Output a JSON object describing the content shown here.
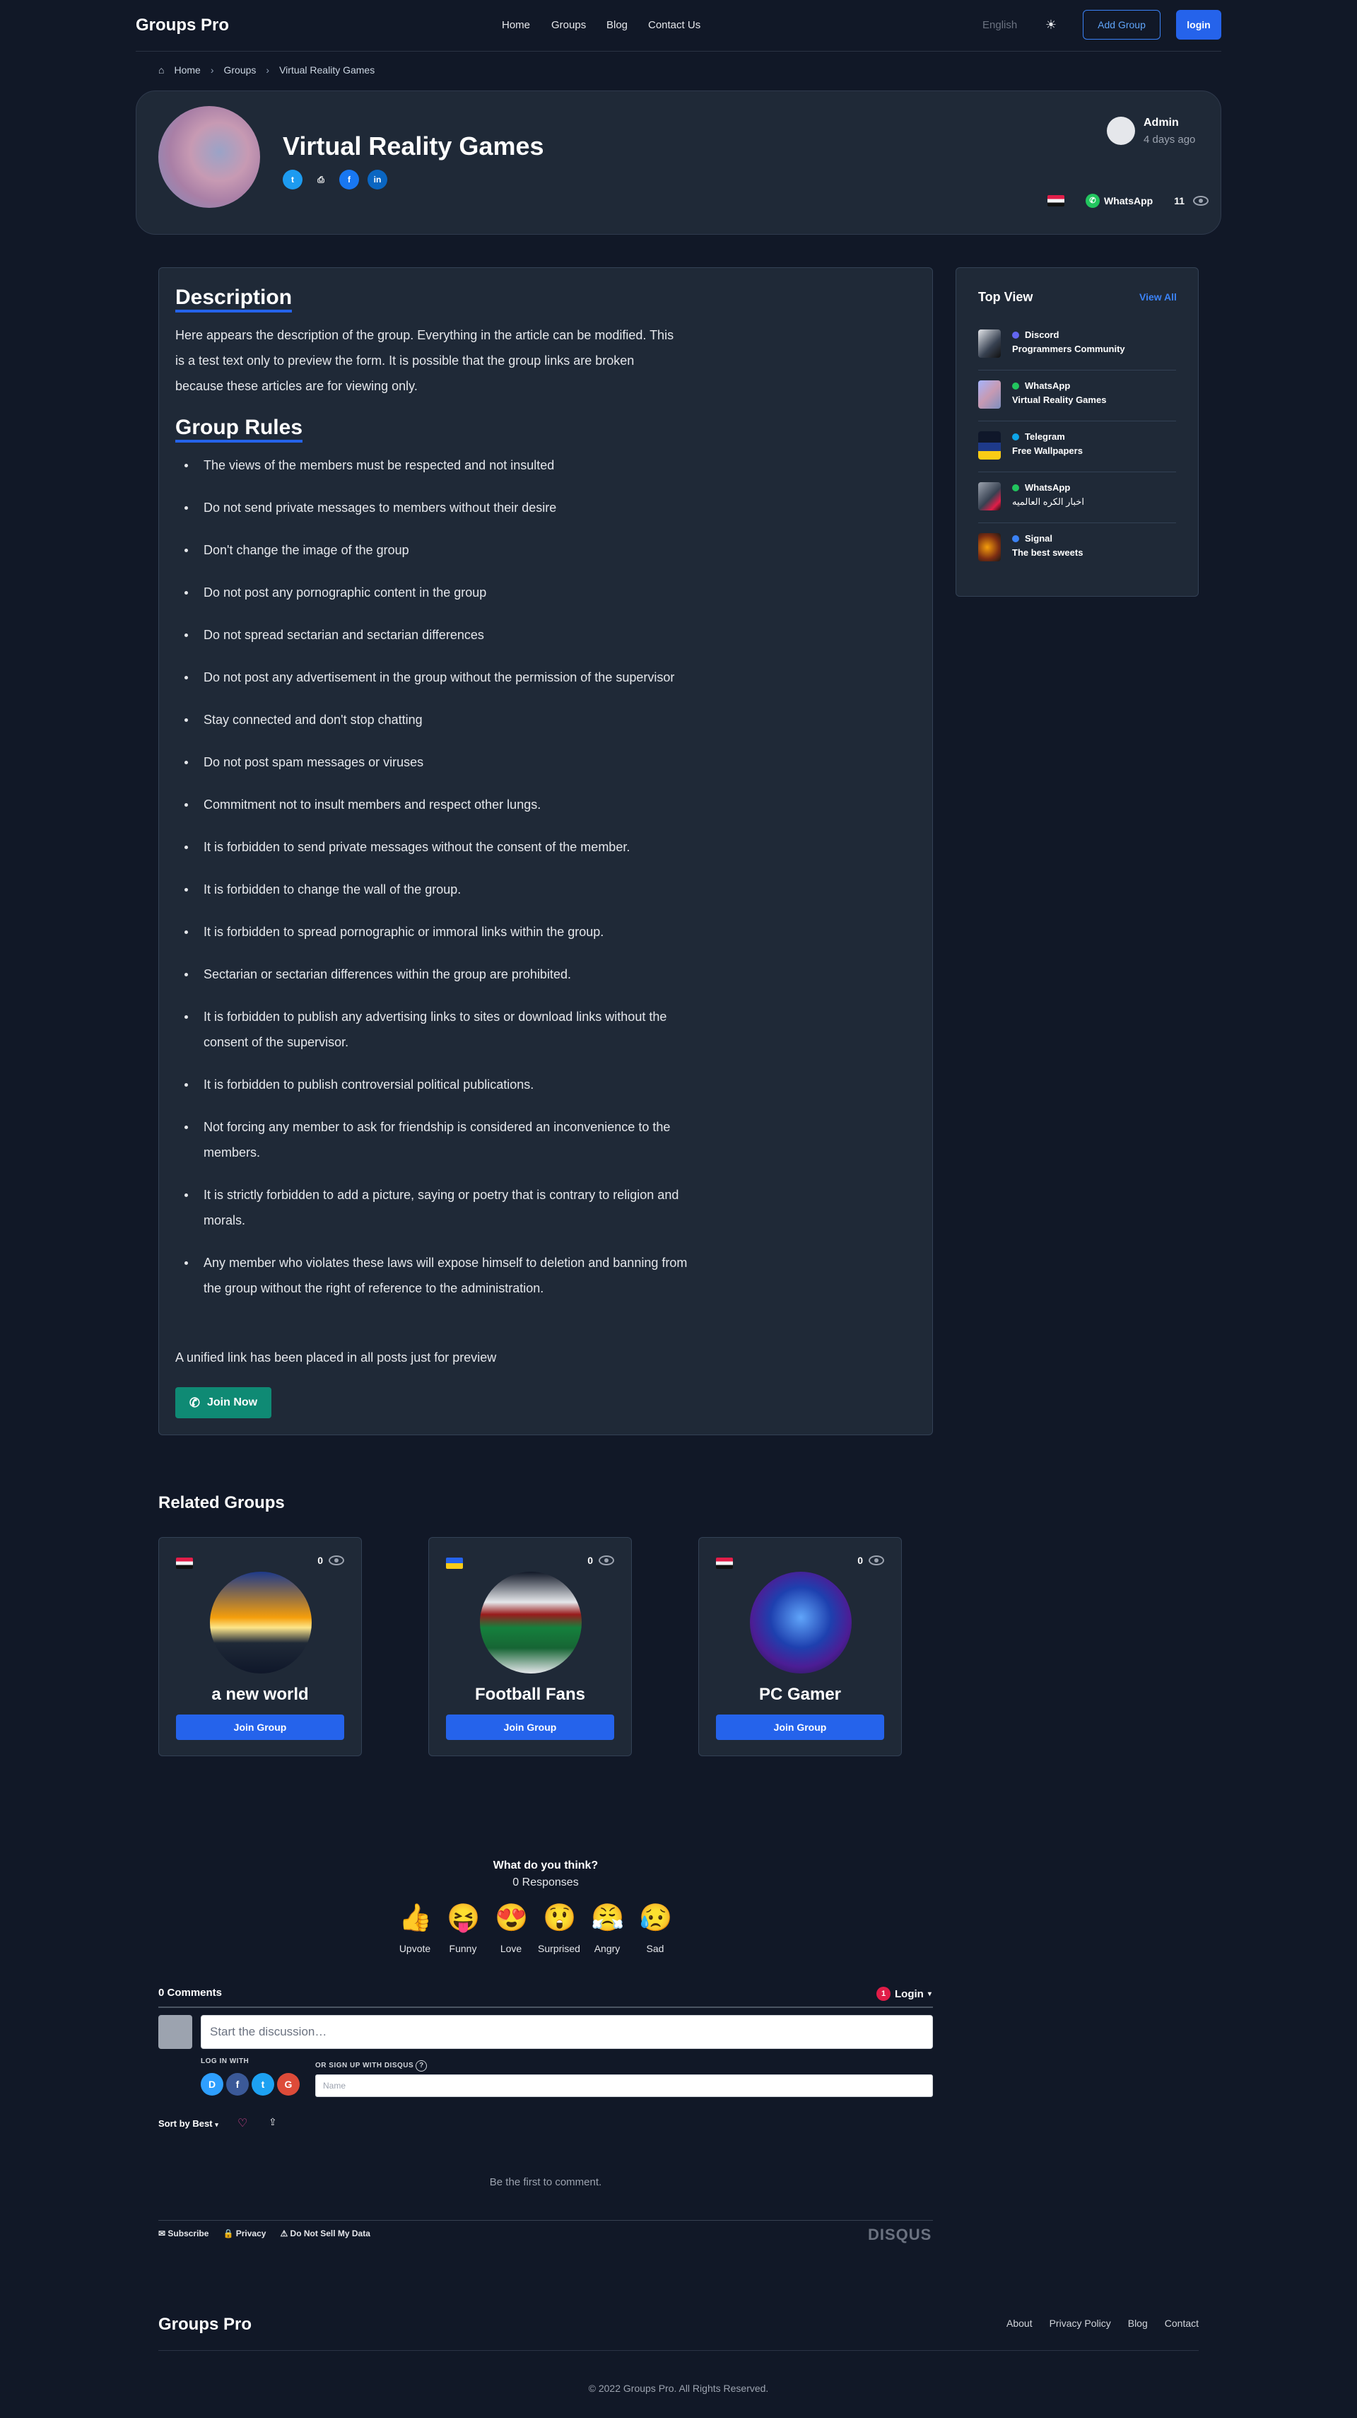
{
  "header": {
    "logo": "Groups Pro",
    "nav": [
      "Home",
      "Groups",
      "Blog",
      "Contact Us"
    ],
    "language": "English",
    "add_group": "Add Group",
    "login": "login"
  },
  "breadcrumb": [
    "Home",
    "Groups",
    "Virtual Reality Games"
  ],
  "group": {
    "title": "Virtual Reality Games",
    "author": "Admin",
    "time": "4 days ago",
    "platform": "WhatsApp",
    "views": "11"
  },
  "content": {
    "description_title": "Description",
    "description": "Here appears the description of the group. Everything in the article can be modified. This is a test text only to preview the form. It is possible that the group links are broken because these articles are for viewing only.",
    "rules_title": "Group Rules",
    "rules": [
      "The views of the members must be respected and not insulted",
      "Do not send private messages to members without their desire",
      "Don't change the image of the group",
      "Do not post any pornographic content in the group",
      "Do not spread sectarian and sectarian differences",
      "Do not post any advertisement in the group without the permission of the supervisor",
      "Stay connected and don't stop chatting",
      "Do not post spam messages or viruses",
      "Commitment not to insult members and respect other lungs.",
      "It is forbidden to send private messages without the consent of the member.",
      "It is forbidden to change the wall of the group.",
      "It is forbidden to spread pornographic or immoral links within the group.",
      "Sectarian or sectarian differences within the group are prohibited.",
      "It is forbidden to publish any advertising links to sites or download links without the consent of the supervisor.",
      "It is forbidden to publish controversial political publications.",
      "Not forcing any member to ask for friendship is considered an inconvenience to the members.",
      "It is strictly forbidden to add a picture, saying or poetry that is contrary to religion and morals.",
      "Any member who violates these laws will expose himself to deletion and banning from the group without the right of reference to the administration."
    ],
    "unified_note": "A unified link has been placed in all posts just for preview",
    "join_now": "Join Now"
  },
  "top_view": {
    "title": "Top View",
    "view_all": "View All",
    "items": [
      {
        "platform": "Discord",
        "name": "Programmers Community",
        "color": "#6366f1"
      },
      {
        "platform": "WhatsApp",
        "name": "Virtual Reality Games",
        "color": "#22c55e"
      },
      {
        "platform": "Telegram",
        "name": "Free Wallpapers",
        "color": "#0ea5e9"
      },
      {
        "platform": "WhatsApp",
        "name": "اخبار الكره العالميه",
        "color": "#22c55e"
      },
      {
        "platform": "Signal",
        "name": "The best sweets",
        "color": "#3b82f6"
      }
    ]
  },
  "related": {
    "title": "Related Groups",
    "join_label": "Join Group",
    "items": [
      {
        "name": "a new world",
        "views": "0",
        "flag": "eg"
      },
      {
        "name": "Football Fans",
        "views": "0",
        "flag": "ua"
      },
      {
        "name": "PC Gamer",
        "views": "0",
        "flag": "eg"
      }
    ]
  },
  "reactions": {
    "question": "What do you think?",
    "responses": "0 Responses",
    "items": [
      {
        "emoji": "👍",
        "label": "Upvote"
      },
      {
        "emoji": "😝",
        "label": "Funny"
      },
      {
        "emoji": "😍",
        "label": "Love"
      },
      {
        "emoji": "😲",
        "label": "Surprised"
      },
      {
        "emoji": "😤",
        "label": "Angry"
      },
      {
        "emoji": "😥",
        "label": "Sad"
      }
    ]
  },
  "disqus": {
    "comments": "0 Comments",
    "login": "Login",
    "login_badge": "1",
    "placeholder": "Start the discussion…",
    "log_in_with": "LOG IN WITH",
    "or_sign_up": "OR SIGN UP WITH DISQUS",
    "name_placeholder": "Name",
    "sort": "Sort by Best",
    "first": "Be the first to comment.",
    "subscribe": "Subscribe",
    "privacy": "Privacy",
    "do_not_sell": "Do Not Sell My Data",
    "brand": "DISQUS"
  },
  "footer": {
    "logo": "Groups Pro",
    "links": [
      "About",
      "Privacy Policy",
      "Blog",
      "Contact"
    ],
    "copyright": "© 2022 Groups Pro. All Rights Reserved."
  }
}
